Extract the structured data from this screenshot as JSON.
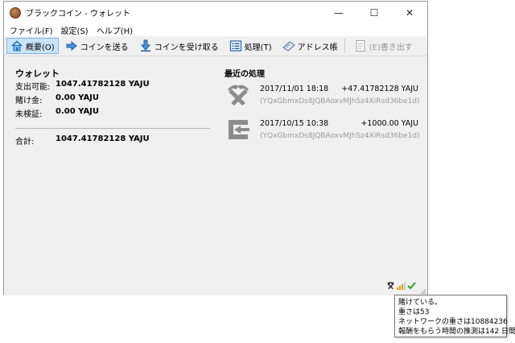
{
  "window": {
    "title": "ブラックコイン - ウォレット",
    "minimize_glyph": "—",
    "maximize_glyph": "☐",
    "close_glyph": "✕"
  },
  "menu": [
    "ファイル(F)",
    "設定(S)",
    "ヘルプ(H)"
  ],
  "toolbar": {
    "overview": "概要(O)",
    "send": "コインを送る",
    "receive": "コインを受け取る",
    "transactions": "処理(T)",
    "address_book": "アドレス帳",
    "export": "(E)書き出す"
  },
  "wallet": {
    "title": "ウォレット",
    "balance_label": "支出可能:",
    "balance_value": "1047.41782128 YAJU",
    "stake_label": "賭け金:",
    "stake_value": "0.00 YAJU",
    "unconfirmed_label": "未検証:",
    "unconfirmed_value": "0.00 YAJU",
    "total_label": "合計:",
    "total_value": "1047.41782128 YAJU"
  },
  "recent": {
    "title": "最近の処理",
    "transactions": [
      {
        "icon": "mined-pickaxe-icon",
        "date": "2017/11/01 18:18",
        "amount": "+47.41782128 YAJU",
        "address": "(YQxGbmxDs8JQBAoxvMJhSz4XiRsd36be1d)"
      },
      {
        "icon": "received-arrow-icon",
        "date": "2017/10/15 10:38",
        "amount": "+1000.00 YAJU",
        "address": "(YQxGbmxDs8JQBAoxvMJhSz4XiRsd36be1d)"
      }
    ]
  },
  "tooltip": {
    "line1": "賭けている。",
    "line2": "重さは53",
    "line3": "ネットワークの重さは10884236",
    "line4": "報酬をもらう時間の推測は142 日間"
  },
  "colors": {
    "accent": "#1e73be",
    "active_tab_bg": "#cce4f7",
    "check_green": "#2aa02a",
    "signal_yellow": "#e0a000"
  }
}
